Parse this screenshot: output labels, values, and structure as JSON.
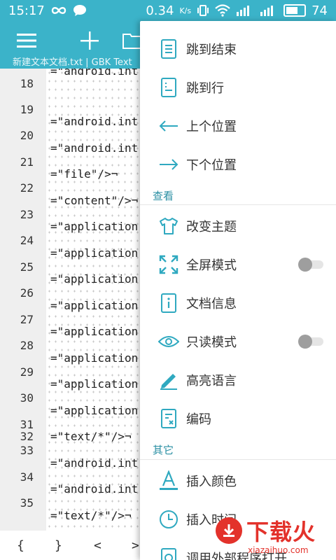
{
  "status_bar": {
    "time": "15:17",
    "speed": "0.34",
    "speed_unit": "K/s",
    "battery": "74"
  },
  "toolbar": {
    "subtitle": "新建文本文档.txt  |  GBK  Text"
  },
  "editor": {
    "line_numbers": [
      "18",
      "19",
      "20",
      "21",
      "22",
      "23",
      "24",
      "25",
      "26",
      "27",
      "28",
      "29",
      "30",
      "31",
      "32",
      "33",
      "34",
      "35"
    ],
    "lines": [
      "=\"android.int",
      "=\"android.int",
      "=\"android.int",
      "=\"file\"/>¬",
      "=\"content\"/>¬",
      "=\"application",
      "=\"application",
      "=\"application",
      "=\"application",
      "=\"application",
      "=\"application",
      "=\"application",
      "=\"application",
      "=\"text/*\"/>¬",
      "=\"android.int",
      "=\"android.int",
      "=\"text/*\"/>¬"
    ]
  },
  "bottom_bar": {
    "keys": [
      "{",
      "}",
      "<",
      ">"
    ]
  },
  "menu": {
    "items_top": [
      {
        "label": "跳到结束",
        "icon": "jump-end-icon"
      },
      {
        "label": "跳到行",
        "icon": "goto-line-icon"
      },
      {
        "label": "上个位置",
        "icon": "arrow-left-icon"
      },
      {
        "label": "下个位置",
        "icon": "arrow-right-icon"
      }
    ],
    "section_view": "查看",
    "items_view": [
      {
        "label": "改变主题",
        "icon": "tshirt-icon"
      },
      {
        "label": "全屏模式",
        "icon": "fullscreen-icon",
        "toggle": false
      },
      {
        "label": "文档信息",
        "icon": "info-icon"
      },
      {
        "label": "只读模式",
        "icon": "eye-icon",
        "toggle": false
      },
      {
        "label": "高亮语言",
        "icon": "pen-icon"
      },
      {
        "label": "编码",
        "icon": "encoding-icon"
      }
    ],
    "section_other": "其它",
    "items_other": [
      {
        "label": "插入颜色",
        "icon": "text-color-icon"
      },
      {
        "label": "插入时间",
        "icon": "clock-icon"
      },
      {
        "label": "调用外部程序打开",
        "icon": "external-icon"
      }
    ]
  },
  "watermark": {
    "brand": "下载火",
    "url": "xiazaihuo.com"
  },
  "colors": {
    "accent": "#3bb3c9",
    "menu_text": "#333333",
    "icon": "#2fa9c0",
    "watermark": "#e3322b"
  }
}
